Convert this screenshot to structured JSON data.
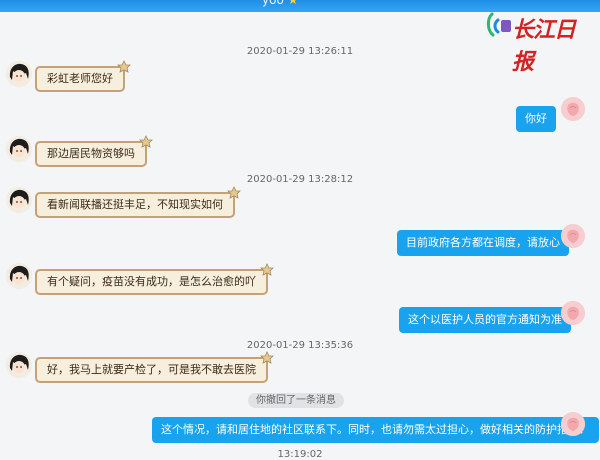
{
  "window": {
    "title": "yoo"
  },
  "brand": {
    "logo_text": "长江日报"
  },
  "colors": {
    "titlebar": "#2a9cf0",
    "outgoing_bubble": "#19a3ef",
    "incoming_bubble": "#f7efdd",
    "incoming_border": "#c4a274",
    "logo_red": "#d32222"
  },
  "timestamps": [
    "2020-01-29 13:26:11",
    "2020-01-29 13:28:12",
    "2020-01-29 13:35:36",
    "13:19:02"
  ],
  "messages": [
    {
      "side": "left",
      "text": "彩虹老师您好"
    },
    {
      "side": "right",
      "text": "你好"
    },
    {
      "side": "left",
      "text": "那边居民物资够吗"
    },
    {
      "side": "left",
      "text": "看新闻联播还挺丰足，不知现实如何"
    },
    {
      "side": "right",
      "text": "目前政府各方都在调度，请放心"
    },
    {
      "side": "left",
      "text": "有个疑问，疫苗没有成功，是怎么治愈的吖"
    },
    {
      "side": "right",
      "text": "这个以医护人员的官方通知为准"
    },
    {
      "side": "left",
      "text": "好，我马上就要产检了，可是我不敢去医院"
    },
    {
      "side": "right",
      "text": "这个情况，请和居住地的社区联系下。同时，也请勿需太过担心，做好相关的防护措施！"
    }
  ],
  "system_notice": "你撤回了一条消息"
}
